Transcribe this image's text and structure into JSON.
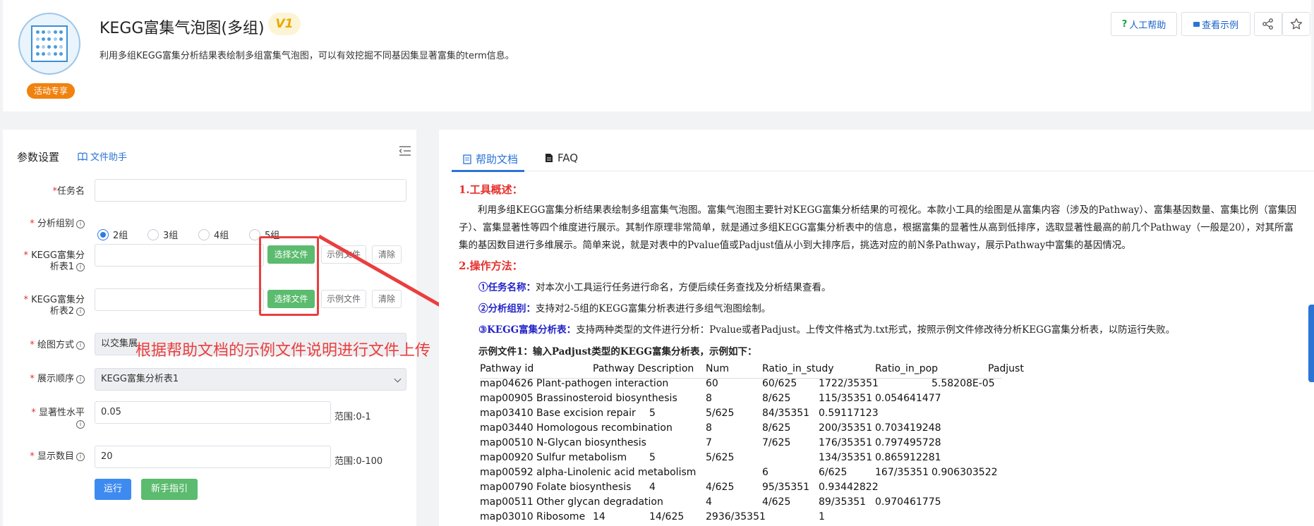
{
  "header": {
    "title": "KEGG富集气泡图(多组)",
    "version_badge": "V1",
    "subtitle": "利用多组KEGG富集分析结果表绘制多组富集气泡图，可以有效挖掘不同基因集显著富集的term信息。",
    "promo_label": "活动专享",
    "help_button": "人工帮助",
    "example_button": "查看示例",
    "share_icon": "share-icon",
    "star_icon": "star-icon"
  },
  "params": {
    "title": "参数设置",
    "helper_link": "文件助手",
    "task_name_label": "任务名",
    "task_name_value": "",
    "group_label": "分析组别",
    "group_options": [
      "2组",
      "3组",
      "4组",
      "5组"
    ],
    "group_selected": "2组",
    "table1_label_a": "KEGG富集分",
    "table1_label_b": "析表1",
    "table2_label_a": "KEGG富集分",
    "table2_label_b": "析表2",
    "choose_file": "选择文件",
    "example_file": "示例文件",
    "clear": "清除",
    "plot_mode_label": "绘图方式",
    "plot_mode_value": "以交集展",
    "order_label": "展示顺序",
    "order_value": "KEGG富集分析表1",
    "sig_label_a": "显著性水平",
    "sig_value": "0.05",
    "sig_range": "范围:0-1",
    "count_label": "显示数目",
    "count_value": "20",
    "count_range": "范围:0-100",
    "run_button": "运行",
    "guide_button": "新手指引"
  },
  "annotation": {
    "text": "根据帮助文档的示例文件说明进行文件上传"
  },
  "doc": {
    "tab_help": "帮助文档",
    "tab_faq": "FAQ",
    "section1_title": "1.工具概述：",
    "section1_text": "利用多组KEGG富集分析结果表绘制多组富集气泡图。富集气泡图主要针对KEGG富集分析结果的可视化。本款小工具的绘图是从富集内容（涉及的Pathway）、富集基因数量、富集比例（富集因子）、富集显著性等四个维度进行展示。其制作原理非常简单，就是通过多组KEGG富集分析表中的信息，根据富集的显著性从高到低排序，选取显著性最高的前几个Pathway（一般是20），对其所富集的基因数目进行多维展示。简单来说，就是对表中的Pvalue值或Padjust值从小到大排序后，挑选对应的前N条Pathway，展示Pathway中富集的基因情况。",
    "section2_title": "2.操作方法：",
    "item1_key": "①任务名称：",
    "item1_text": "对本次小工具运行任务进行命名，方便后续任务查找及分析结果查看。",
    "item2_key": "②分析组别：",
    "item2_text": "支持对2-5组的KEGG富集分析表进行多组气泡图绘制。",
    "item3_key": "③KEGG富集分析表：",
    "item3_text": "支持两种类型的文件进行分析：Pvalue或者Padjust。上传文件格式为.txt形式，按照示例文件修改待分析KEGG富集分析表，以防运行失败。",
    "example_title": "示例文件1：输入Padjust类型的KEGG富集分析表，示例如下：",
    "table_headers": [
      "Pathway id",
      "Pathway Description",
      "Num",
      "Ratio_in_study",
      "Ratio_in_pop",
      "Padjust"
    ],
    "table_rows": [
      [
        "map04626",
        "Plant-pathogen interaction",
        "60",
        "60/625",
        "1722/35351",
        "5.58208E-05"
      ],
      [
        "map00905",
        "Brassinosteroid biosynthesis",
        "8",
        "8/625",
        "115/35351",
        "0.054641477"
      ],
      [
        "map03410",
        "Base excision repair",
        "5",
        "5/625",
        "84/35351",
        "0.59117123"
      ],
      [
        "map03440",
        "Homologous recombination",
        "8",
        "8/625",
        "200/35351",
        "0.703419248"
      ],
      [
        "map00510",
        "N-Glycan biosynthesis",
        "7",
        "7/625",
        "176/35351",
        "0.797495728"
      ],
      [
        "map00920",
        "Sulfur metabolism",
        "5",
        "5/625",
        "134/35351",
        "0.865912281"
      ],
      [
        "map00592",
        "alpha-Linolenic acid metabolism",
        "6",
        "6/625",
        "167/35351",
        "0.906303522"
      ],
      [
        "map00790",
        "Folate biosynthesis",
        "4",
        "4/625",
        "95/35351",
        "0.93442822"
      ],
      [
        "map00511",
        "Other glycan degradation",
        "4",
        "4/625",
        "89/35351",
        "0.970461775"
      ],
      [
        "map03010",
        "Ribosome",
        "14",
        "14/625",
        "2936/35351",
        "1"
      ]
    ]
  },
  "colors": {
    "accent": "#2a74d6",
    "annotation_red": "#ea3e3e",
    "green_button": "#5bbb6e",
    "promo_orange": "#f0820f"
  }
}
